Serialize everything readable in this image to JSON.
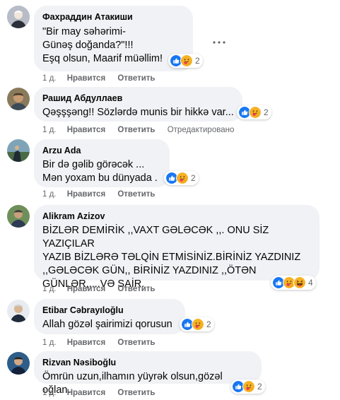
{
  "actions": {
    "like_label": "Нравится",
    "reply_label": "Ответить",
    "edited_label": "Отредактировано"
  },
  "comments": [
    {
      "author": "Фахраддин Атакиши",
      "text": "\"Bir may səhərimi-\nGünəş doğanda?\"!!!\nEşq olsun, Maarif müəllim!",
      "age": "1 д.",
      "reaction_count": "2",
      "reactions": [
        "like-icon",
        "care-icon"
      ]
    },
    {
      "author": "Рашид Абдуллаев",
      "text": "Qəşşşəng!! Sözlərdə munis bir hikkə var...",
      "age": "1 д.",
      "reaction_count": "2",
      "reactions": [
        "like-icon",
        "care-icon"
      ]
    },
    {
      "author": "Arzu Ada",
      "text": "Bir də gəlib görəcək ...\nMən yoxam bu dünyada .",
      "age": "1 д.",
      "reaction_count": "2",
      "reactions": [
        "like-icon",
        "care-icon"
      ]
    },
    {
      "author": "Alikram Azizov",
      "text": "BİZLƏR DEMİRİK ,,VAXT GƏLƏCƏK ,,. ONU SİZ YAZIÇILAR\nYAZIB BİZLƏRƏ TƏLQİN ETMİSİNİZ.BİRİNİZ YAZDINIZ\n,,GƏLƏCƏK GÜN,, BİRİNİZ YAZDINIZ ,,ÖTƏN\nGÜNLƏR,,...VƏ SAİR.",
      "age": "1 д.",
      "reaction_count": "4",
      "reactions": [
        "like-icon",
        "care-icon",
        "haha-icon"
      ]
    },
    {
      "author": "Etibar Cəbrayıloğlu",
      "text": "Allah gözəl şairimizi qorusun",
      "age": "1 д.",
      "reaction_count": "2",
      "reactions": [
        "like-icon",
        "care-icon"
      ]
    },
    {
      "author": "Rizvan Nəsiboğlu",
      "text": "Ömrün uzun,ilhamın yüyrək olsun,gözəl oğlan.",
      "age": "1 д.",
      "reaction_count": "2",
      "reactions": [
        "like-icon",
        "care-icon"
      ]
    }
  ],
  "colors": {
    "bubble": "#f0f2f5",
    "meta": "#65676b",
    "like": "#1877f2",
    "care": "#f7b125",
    "haha": "#f7b125"
  }
}
